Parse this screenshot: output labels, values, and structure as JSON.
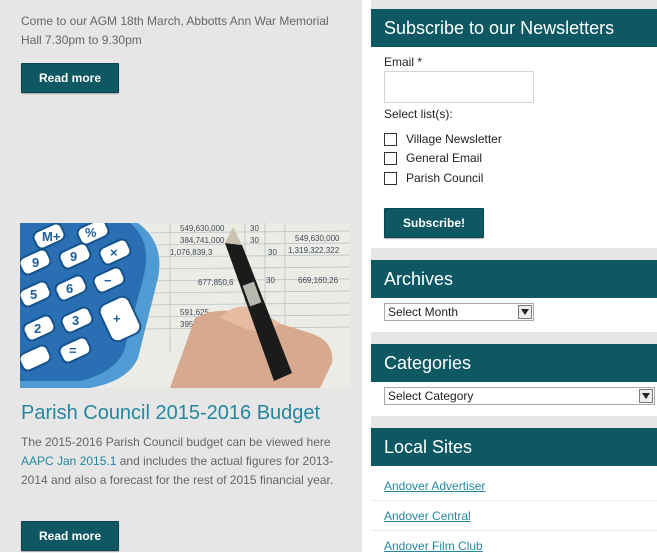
{
  "main": {
    "post1": {
      "excerpt": "Come to our AGM 18th March,  Abbotts Ann War Memorial Hall 7.30pm  to 9.30pm",
      "read_more": "Read more"
    },
    "post2": {
      "image_label": "calculator-and-spreadsheet-photo",
      "title": "Parish Council 2015-2016 Budget",
      "body_before": "The 2015-2016 Parish Council budget can be viewed here ",
      "link_text": "AAPC Jan 2015.1",
      "body_after": " and includes the actual figures for 2013-2014 and also a forecast for the rest of 2015 financial year.",
      "read_more": "Read more"
    }
  },
  "sidebar": {
    "newsletter": {
      "title": "Subscribe to our Newsletters",
      "email_label": "Email *",
      "email_value": "",
      "select_lists_label": "Select list(s):",
      "lists": [
        "Village Newsletter",
        "General Email",
        "Parish Council"
      ],
      "subscribe_label": "Subscribe!"
    },
    "archives": {
      "title": "Archives",
      "selected": "Select Month"
    },
    "categories": {
      "title": "Categories",
      "selected": "Select Category"
    },
    "local_sites": {
      "title": "Local Sites",
      "links": [
        "Andover Advertiser",
        "Andover Central",
        "Andover Film Club"
      ]
    }
  },
  "colors": {
    "accent": "#0d5862",
    "link": "#2487a0",
    "main_bg": "#e6e6e6"
  }
}
